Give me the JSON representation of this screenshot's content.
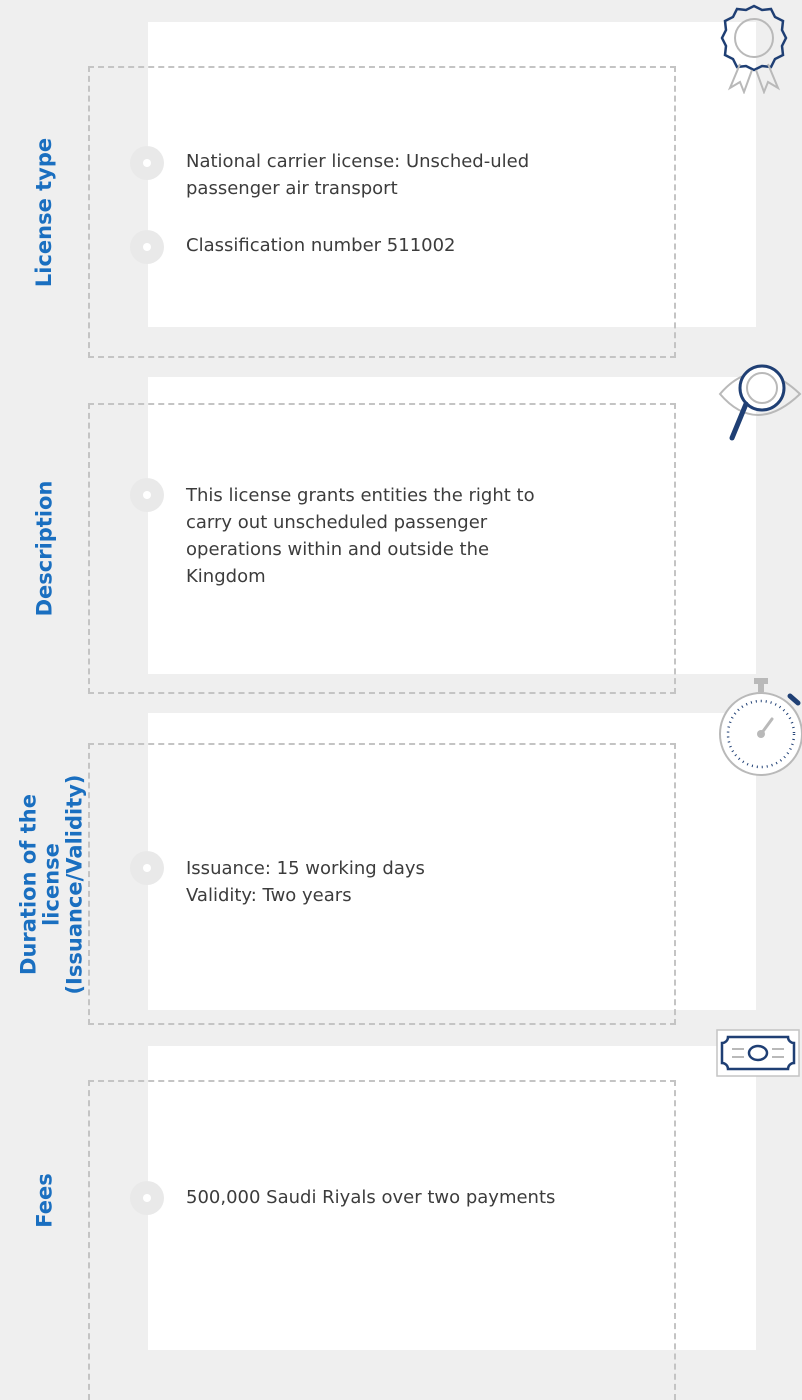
{
  "sections": [
    {
      "label": "License type",
      "items": [
        "National carrier license: Unsched-uled passenger air transport",
        "Classification number 511002"
      ],
      "icon": "award-badge-icon"
    },
    {
      "label": "Description",
      "items": [
        "This license grants entities the right to carry out unscheduled passenger operations within and outside the Kingdom"
      ],
      "icon": "magnifier-eye-icon"
    },
    {
      "label_lines": [
        "Duration of the",
        "license",
        "(Issuance/Validity)"
      ],
      "items": [
        "Issuance: 15 working days",
        "Validity: Two years"
      ],
      "icon": "stopwatch-icon"
    },
    {
      "label": "Fees",
      "items": [
        "500,000 Saudi Riyals over two payments"
      ],
      "icon": "banknote-icon"
    }
  ],
  "colors": {
    "accent": "#1a6fc0",
    "icon_navy": "#1f3f74",
    "background": "#efefef",
    "card": "#ffffff",
    "text": "#3c3c3c"
  }
}
